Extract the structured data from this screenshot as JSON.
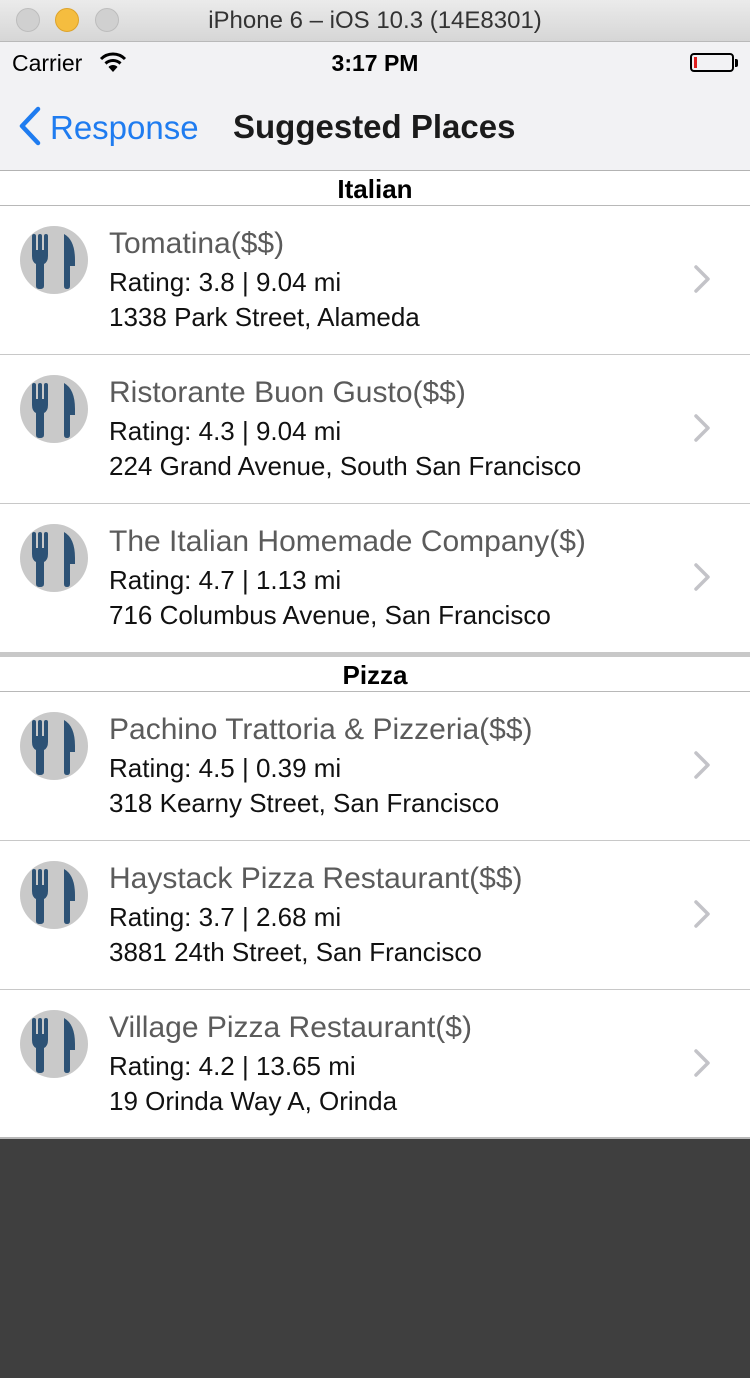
{
  "window": {
    "title": "iPhone 6 – iOS 10.3 (14E8301)"
  },
  "status_bar": {
    "carrier": "Carrier",
    "time": "3:17 PM",
    "icons": [
      "wifi-icon",
      "battery-icon"
    ]
  },
  "nav": {
    "back_label": "Response",
    "title": "Suggested Places"
  },
  "colors": {
    "accent": "#1f7cf0",
    "icon_fg": "#2d5275",
    "icon_bg": "#c9c9c9",
    "background": "#3f3f3f"
  },
  "sections": [
    {
      "title": "Italian",
      "rows": [
        {
          "name": "Tomatina($$)",
          "rating": "Rating: 3.8 | 9.04 mi",
          "address": "1338 Park Street, Alameda"
        },
        {
          "name": "Ristorante Buon Gusto($$)",
          "rating": "Rating: 4.3 | 9.04 mi",
          "address": "224 Grand Avenue, South San Francisco"
        },
        {
          "name": "The Italian Homemade Company($)",
          "rating": "Rating: 4.7 | 1.13 mi",
          "address": "716 Columbus Avenue, San Francisco"
        }
      ]
    },
    {
      "title": "Pizza",
      "rows": [
        {
          "name": "Pachino Trattoria & Pizzeria($$)",
          "rating": "Rating: 4.5 | 0.39 mi",
          "address": "318 Kearny Street, San Francisco"
        },
        {
          "name": "Haystack Pizza Restaurant($$)",
          "rating": "Rating: 3.7 | 2.68 mi",
          "address": "3881 24th Street, San Francisco"
        },
        {
          "name": "Village Pizza Restaurant($)",
          "rating": "Rating: 4.2 | 13.65 mi",
          "address": "19 Orinda Way A, Orinda"
        }
      ]
    }
  ]
}
